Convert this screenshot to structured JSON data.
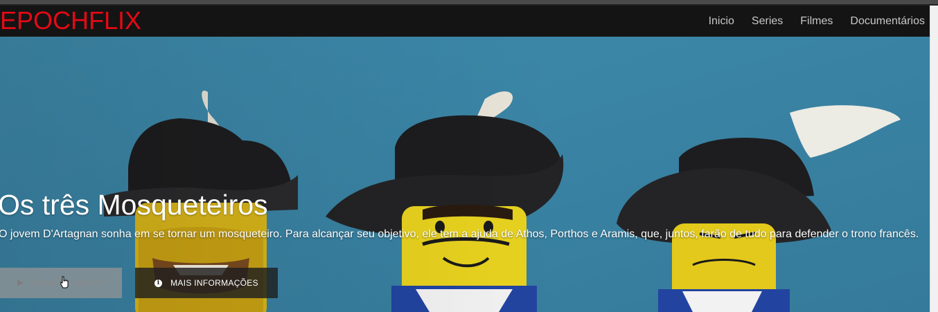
{
  "brand": {
    "name": "EPOCHFLIX"
  },
  "nav": {
    "items": [
      {
        "label": "Inicio"
      },
      {
        "label": "Series"
      },
      {
        "label": "Filmes"
      },
      {
        "label": "Documentários"
      }
    ]
  },
  "hero": {
    "title": "Os três Mosqueteiros",
    "description": "O jovem D'Artagnan sonha em se tornar um mosqueteiro. Para alcançar seu objetivo, ele tem a ajuda de Athos, Porthos e Aramis, que, juntos, farão de tudo para defender o trono francês.",
    "play_button": {
      "label": "ASSISTIR AGORA",
      "icon": "play-icon"
    },
    "info_button": {
      "label": "MAIS INFORMAÇÕES",
      "icon": "info-icon"
    }
  },
  "colors": {
    "brand_red": "#e50914",
    "navbar_bg": "#141414",
    "hero_bg": "#3d86a8"
  }
}
